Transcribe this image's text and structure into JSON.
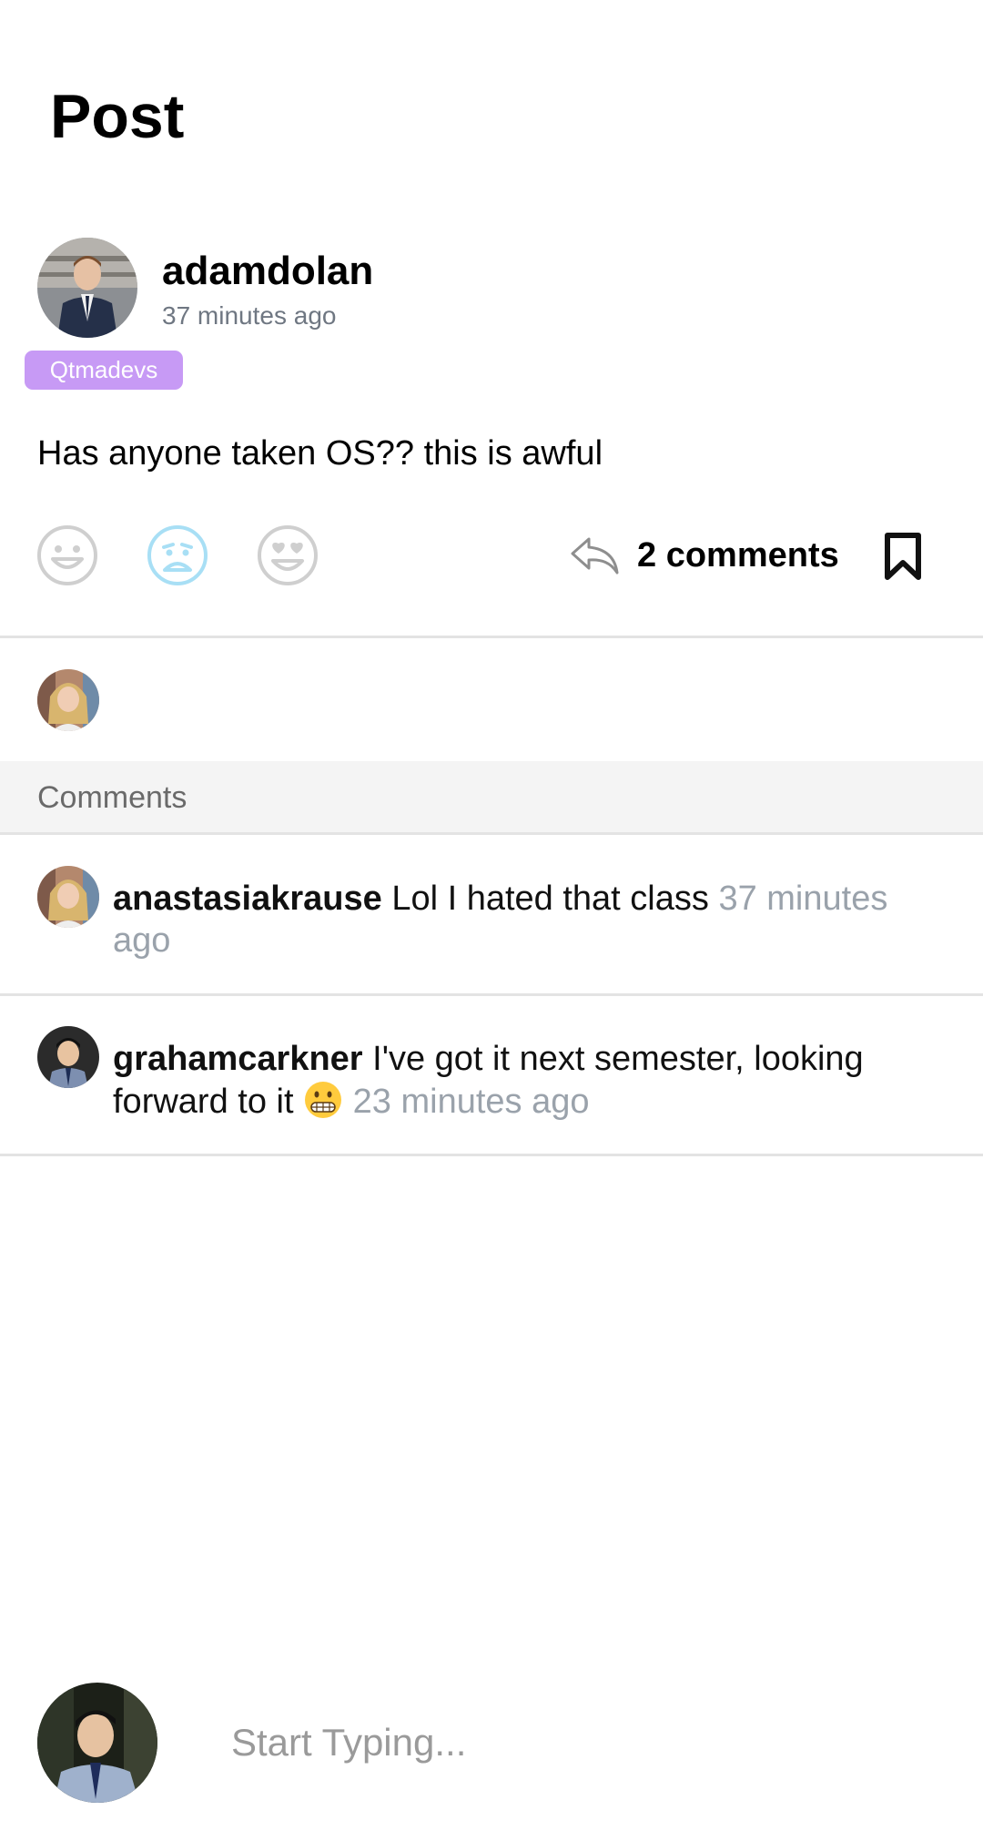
{
  "header": {
    "title": "Post"
  },
  "post": {
    "author": "adamdolan",
    "time": "37 minutes ago",
    "group_badge": "Qtmadevs",
    "body": "Has anyone taken OS?? this is awful",
    "reactions": [
      {
        "icon": "smile-icon",
        "color": "#cfcfcf",
        "selected": false
      },
      {
        "icon": "sad-face-icon",
        "color": "#a8dff5",
        "selected": true
      },
      {
        "icon": "heart-eyes-icon",
        "color": "#cfcfcf",
        "selected": false
      }
    ],
    "comments_count_label": "2 comments",
    "reply_icon": "reply-icon",
    "bookmark_icon": "bookmark-icon"
  },
  "comments_section": {
    "header": "Comments"
  },
  "comments": [
    {
      "user": "anastasiakrause",
      "text": "Lol I hated that class",
      "time": "37 minutes ago"
    },
    {
      "user": "grahamcarkner",
      "text": "I've got it next semester, looking forward to it",
      "emoji": "grimacing-face-emoji",
      "time": "23 minutes ago"
    }
  ],
  "composer": {
    "placeholder": "Start Typing..."
  },
  "colors": {
    "badge": "#c79af5",
    "muted_text": "#6f7782",
    "timestamp": "#9aa2ab",
    "divider": "#e3e3e3",
    "section_bg": "#f4f4f4",
    "selected_reaction": "#a8dff5"
  }
}
